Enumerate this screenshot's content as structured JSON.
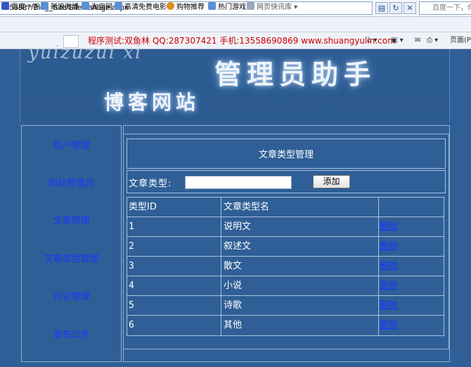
{
  "browser": {
    "address": "st:56887/Blog_Site/SiteManage.aspx",
    "search_placeholder": "百度一下，你",
    "favorites": [
      "百度一下",
      "新浪微博",
      "淘宝网",
      "高清免费电影",
      "购物推荐",
      "热门游戏",
      "网页快讯库"
    ],
    "marquee": "程序测试:双鱼林 QQ:287307421 手机:13558690869 www.shuangyulin.com",
    "page_menu": "页面(P"
  },
  "banner": {
    "script_text": "yuizuzui xi",
    "title": "管理员助手",
    "subtitle": "博客网站"
  },
  "sidebar": {
    "items": [
      "用户管理",
      "网站管理员",
      "文章管理",
      "文章类型管理",
      "评论管理",
      "发布公告"
    ]
  },
  "form": {
    "title": "文章类型管理",
    "type_label": "文章类型:",
    "type_value": "",
    "add_label": "添加"
  },
  "table": {
    "columns": [
      "类型ID",
      "文章类型名",
      ""
    ],
    "rows": [
      {
        "id": "1",
        "name": "说明文",
        "action": "删除"
      },
      {
        "id": "2",
        "name": "叙述文",
        "action": "删除"
      },
      {
        "id": "3",
        "name": "散文",
        "action": "删除"
      },
      {
        "id": "4",
        "name": "小说",
        "action": "删除"
      },
      {
        "id": "5",
        "name": "诗歌",
        "action": "删除"
      },
      {
        "id": "6",
        "name": "其他",
        "action": "删除"
      }
    ]
  },
  "colors": {
    "page_background": "#2f5f96",
    "link": "#1a36ff",
    "marquee": "#d00000"
  }
}
